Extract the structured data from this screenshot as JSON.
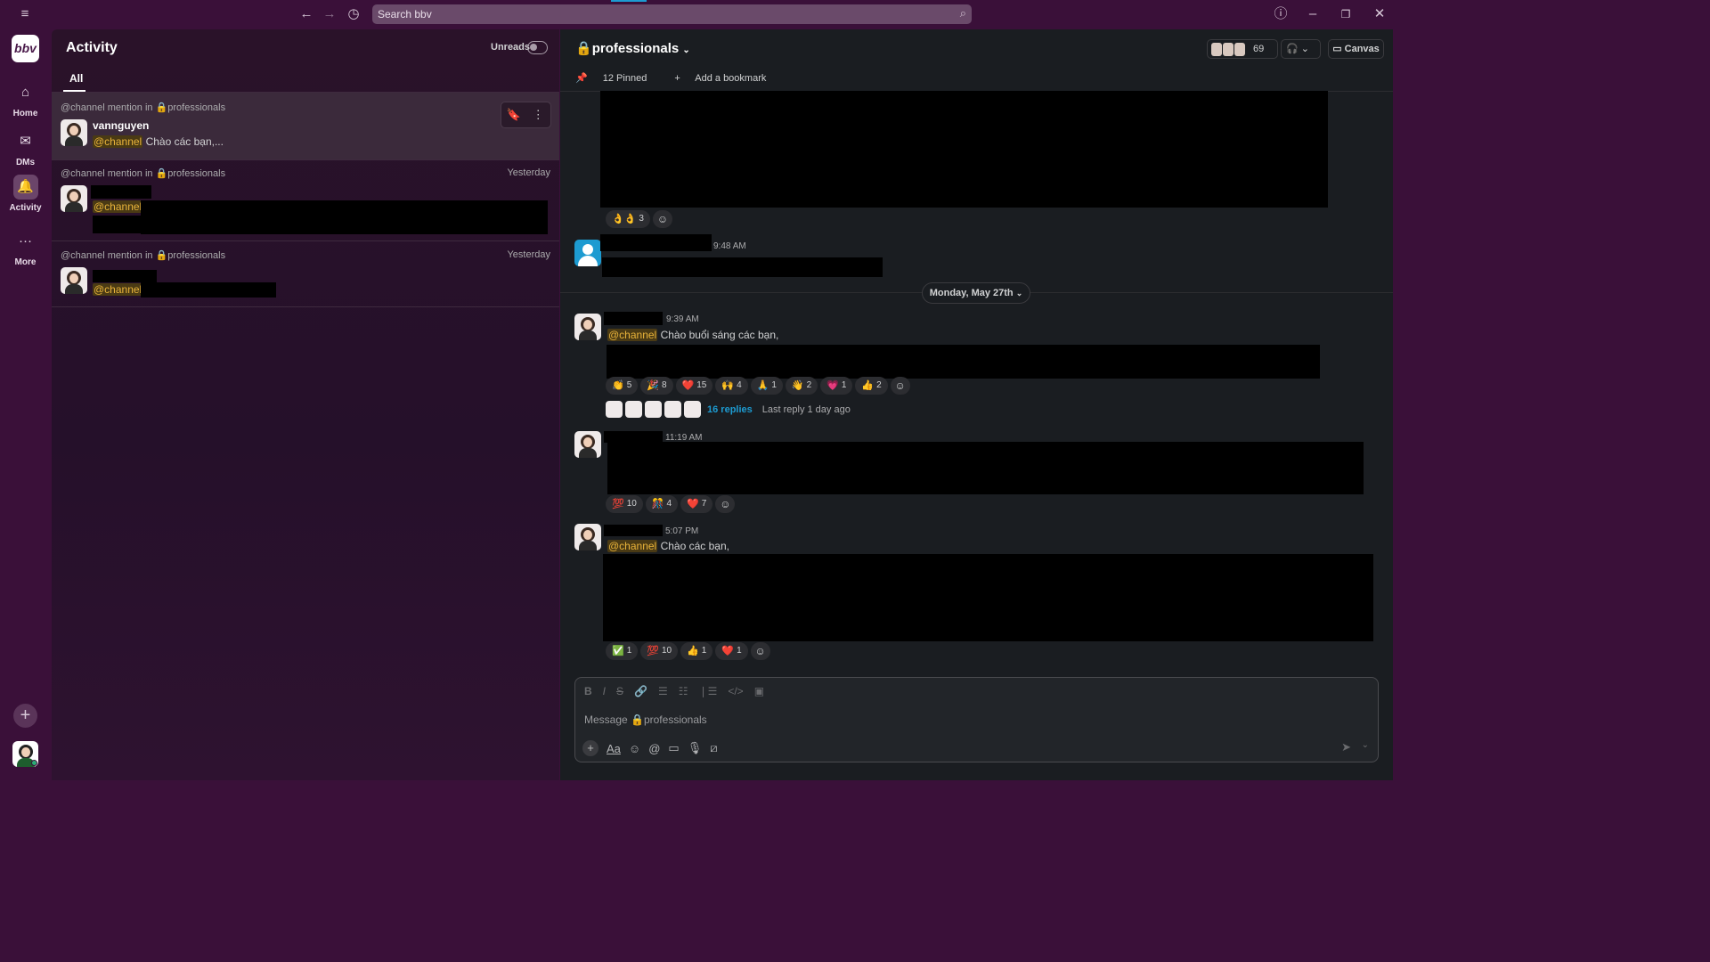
{
  "titlebar": {
    "search_placeholder": "Search bbv",
    "menu_icon": "hamburger-menu-icon",
    "back_icon": "arrow-left-icon",
    "forward_icon": "arrow-right-icon",
    "history_icon": "clock-icon",
    "help_icon": "help-circle-icon",
    "minimize_icon": "minimize-icon",
    "restore_icon": "restore-icon",
    "close_icon": "close-icon"
  },
  "workspace": {
    "logo_text": "bbv"
  },
  "rail": {
    "items": [
      {
        "label": "Home",
        "icon": "home-icon"
      },
      {
        "label": "DMs",
        "icon": "dms-icon"
      },
      {
        "label": "Activity",
        "icon": "bell-icon"
      },
      {
        "label": "More",
        "icon": "more-dots-icon"
      }
    ]
  },
  "activity": {
    "title": "Activity",
    "unreads_label": "Unreads",
    "tab_all": "All",
    "items": [
      {
        "meta": "@channel mention in",
        "channel": "professionals",
        "date": "",
        "author": "vannguyen",
        "mention": "@channel",
        "text": "Chào các bạn,..."
      },
      {
        "meta": "@channel mention in",
        "channel": "professionals",
        "date": "Yesterday",
        "author": "",
        "mention": "@channel",
        "text": ""
      },
      {
        "meta": "@channel mention in",
        "channel": "professionals",
        "date": "Yesterday",
        "author": "",
        "mention": "@channel",
        "text": ""
      }
    ]
  },
  "channel": {
    "name": "professionals",
    "member_count": "69",
    "canvas_label": "Canvas",
    "pinned_label": "12 Pinned",
    "bookmark_label": "Add a bookmark",
    "date_divider": "Monday, May 27th",
    "messages": [
      {
        "time": "",
        "reactions": [
          {
            "emoji": "👌👌",
            "count": "3"
          }
        ]
      },
      {
        "time": "9:48 AM",
        "reactions": []
      },
      {
        "time": "9:39 AM",
        "mention": "@channel",
        "text": "Chào buổi sáng các bạn,",
        "reactions": [
          {
            "emoji": "👏",
            "count": "5"
          },
          {
            "emoji": "🎉",
            "count": "8"
          },
          {
            "emoji": "❤️",
            "count": "15"
          },
          {
            "emoji": "🙌",
            "count": "4"
          },
          {
            "emoji": "🙏",
            "count": "1"
          },
          {
            "emoji": "👋",
            "count": "2"
          },
          {
            "emoji": "💗",
            "count": "1"
          },
          {
            "emoji": "👍",
            "count": "2"
          }
        ],
        "replies_count": "16 replies",
        "last_reply": "Last reply 1 day ago"
      },
      {
        "time": "11:19 AM",
        "reactions": [
          {
            "emoji": "💯",
            "count": "10"
          },
          {
            "emoji": "🎊",
            "count": "4"
          },
          {
            "emoji": "❤️",
            "count": "7"
          }
        ]
      },
      {
        "time": "5:07 PM",
        "mention": "@channel",
        "text": "Chào các bạn,",
        "reactions": [
          {
            "emoji": "✅",
            "count": "1"
          },
          {
            "emoji": "💯",
            "count": "10"
          },
          {
            "emoji": "👍",
            "count": "1"
          },
          {
            "emoji": "❤️",
            "count": "1"
          }
        ]
      }
    ]
  },
  "composer": {
    "placeholder": "Message 🔒professionals",
    "text_style_label": "Aa"
  },
  "colors": {
    "sidebar": "#3a1039",
    "mention_text": "#e8b33a",
    "link": "#1d9bd1"
  }
}
